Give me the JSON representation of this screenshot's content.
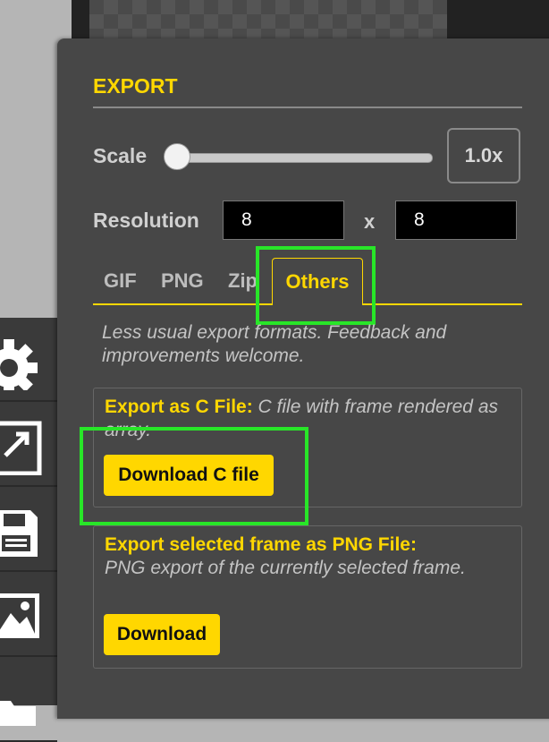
{
  "export": {
    "title": "EXPORT",
    "scale_label": "Scale",
    "scale_value": "1.0x",
    "scale_fraction": 0.0,
    "resolution_label": "Resolution",
    "resolution_width": "8",
    "resolution_separator": "x",
    "resolution_height": "8",
    "tabs": [
      {
        "label": "GIF"
      },
      {
        "label": "PNG"
      },
      {
        "label": "Zip"
      },
      {
        "label": "Others",
        "active": true
      }
    ],
    "others_description": "Less usual export formats. Feedback and improvements welcome.",
    "c_file": {
      "title": "Export as C File:",
      "description": "C file with frame rendered as array.",
      "button": "Download C file"
    },
    "png_frame": {
      "title": "Export selected frame as PNG File:",
      "description": "PNG export of the currently selected frame.",
      "button": "Download"
    }
  },
  "toolbar": {
    "icons": [
      "gear-icon",
      "resize-icon",
      "save-icon",
      "image-icon",
      "folder-icon"
    ]
  },
  "colors": {
    "accent": "#ffd700",
    "panel_bg": "#474747",
    "highlight": "#28e628"
  }
}
